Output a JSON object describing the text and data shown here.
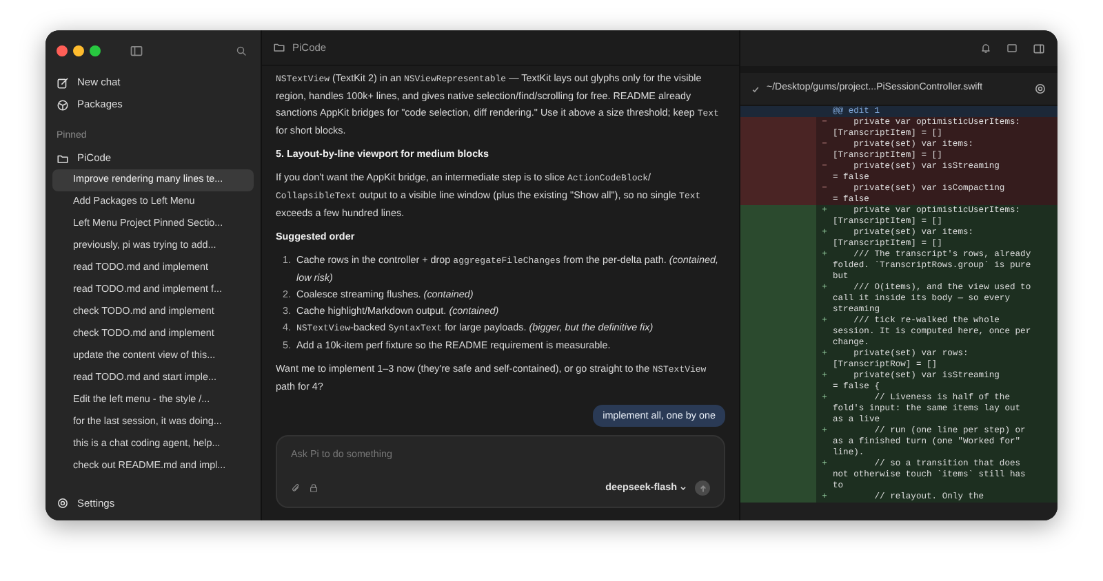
{
  "sidebar": {
    "actions": [
      {
        "kind": "new",
        "label": "New chat"
      },
      {
        "kind": "packages",
        "label": "Packages"
      }
    ],
    "section": "Pinned",
    "project": "PiCode",
    "sessions": [
      {
        "title": "Improve rendering many lines te...",
        "selected": true
      },
      {
        "title": "Add Packages to Left Menu",
        "selected": false
      },
      {
        "title": "Left Menu Project Pinned Sectio...",
        "selected": false
      },
      {
        "title": "previously, pi was trying to add...",
        "selected": false
      },
      {
        "title": "read TODO.md and implement",
        "selected": false
      },
      {
        "title": "read TODO.md and implement f...",
        "selected": false
      },
      {
        "title": "check TODO.md and implement",
        "selected": false
      },
      {
        "title": "check TODO.md and implement",
        "selected": false
      },
      {
        "title": "update the content view of this...",
        "selected": false
      },
      {
        "title": "read TODO.md and start imple...",
        "selected": false
      },
      {
        "title": "Edit the left menu - the style /...",
        "selected": false
      },
      {
        "title": "for the last session, it was doing...",
        "selected": false
      },
      {
        "title": "this is a chat coding agent, help...",
        "selected": false
      },
      {
        "title": "check out README.md and impl...",
        "selected": false
      }
    ],
    "settings": "Settings"
  },
  "chat": {
    "title": "PiCode",
    "blocks": [
      {
        "kind": "para",
        "segments": [
          {
            "kind": "code",
            "text": "NSTextView"
          },
          {
            "kind": "plain",
            "text": " (TextKit 2) in an "
          },
          {
            "kind": "code",
            "text": "NSViewRepresentable"
          },
          {
            "kind": "plain",
            "text": " — TextKit lays out glyphs only for the visible region, handles 100k+ lines, and gives native selection/find/scrolling for free. README already sanctions AppKit bridges for \"code selection, diff rendering.\" Use it above a size threshold; keep "
          },
          {
            "kind": "code",
            "text": "Text"
          },
          {
            "kind": "plain",
            "text": " for short blocks."
          }
        ]
      },
      {
        "kind": "heading",
        "segments": [
          {
            "kind": "plain",
            "text": "5. Layout-by-line viewport for medium blocks"
          }
        ]
      },
      {
        "kind": "para",
        "segments": [
          {
            "kind": "plain",
            "text": "If you don't want the AppKit bridge, an intermediate step is to slice "
          },
          {
            "kind": "code",
            "text": "ActionCodeBlock"
          },
          {
            "kind": "plain",
            "text": "/ "
          },
          {
            "kind": "code",
            "text": "CollapsibleText"
          },
          {
            "kind": "plain",
            "text": " output to a visible line window (plus the existing \"Show all\"), so no single "
          },
          {
            "kind": "code",
            "text": "Text"
          },
          {
            "kind": "plain",
            "text": " exceeds a few hundred lines."
          }
        ]
      },
      {
        "kind": "heading",
        "segments": [
          {
            "kind": "plain",
            "text": "Suggested order"
          }
        ]
      },
      {
        "kind": "list",
        "items": [
          {
            "number": "1.",
            "segments": [
              {
                "kind": "plain",
                "text": "Cache rows in the controller + drop "
              },
              {
                "kind": "code",
                "text": "aggregateFileChanges"
              },
              {
                "kind": "plain",
                "text": " from the per-delta path. "
              },
              {
                "kind": "italic",
                "text": "(contained, low risk)"
              }
            ]
          },
          {
            "number": "2.",
            "segments": [
              {
                "kind": "plain",
                "text": "Coalesce streaming flushes. "
              },
              {
                "kind": "italic",
                "text": "(contained)"
              }
            ]
          },
          {
            "number": "3.",
            "segments": [
              {
                "kind": "plain",
                "text": "Cache highlight/Markdown output. "
              },
              {
                "kind": "italic",
                "text": "(contained)"
              }
            ]
          },
          {
            "number": "4.",
            "segments": [
              {
                "kind": "code",
                "text": "NSTextView"
              },
              {
                "kind": "plain",
                "text": "-backed "
              },
              {
                "kind": "code",
                "text": "SyntaxText"
              },
              {
                "kind": "plain",
                "text": " for large payloads. "
              },
              {
                "kind": "italic",
                "text": "(bigger, but the definitive fix)"
              }
            ]
          },
          {
            "number": "5.",
            "segments": [
              {
                "kind": "plain",
                "text": "Add a 10k-item perf fixture so the README requirement is measurable."
              }
            ]
          }
        ]
      },
      {
        "kind": "para",
        "segments": [
          {
            "kind": "plain",
            "text": "Want me to implement 1–3 now (they're safe and self-contained), or go straight to the "
          },
          {
            "kind": "code",
            "text": "NSTextView"
          },
          {
            "kind": "plain",
            "text": " path for 4?"
          }
        ]
      }
    ],
    "user_message": "implement all, one by one",
    "composer": {
      "placeholder": "Ask Pi to do something",
      "model": "deepseek-flash"
    }
  },
  "diff": {
    "file": "~/Desktop/gums/project...PiSessionController.swift",
    "lines": [
      {
        "kind": "hunk",
        "lines": [
          "@@ edit 1"
        ]
      },
      {
        "kind": "del",
        "sign": "−",
        "lines": [
          "    private var optimisticUserItems:",
          "[TranscriptItem] = []"
        ]
      },
      {
        "kind": "del",
        "sign": "−",
        "lines": [
          "    private(set) var items:",
          "[TranscriptItem] = []"
        ]
      },
      {
        "kind": "del",
        "sign": "−",
        "lines": [
          "    private(set) var isStreaming",
          "= false"
        ]
      },
      {
        "kind": "del",
        "sign": "−",
        "lines": [
          "    private(set) var isCompacting",
          "= false"
        ]
      },
      {
        "kind": "add",
        "sign": "+",
        "lines": [
          "    private var optimisticUserItems:",
          "[TranscriptItem] = []"
        ]
      },
      {
        "kind": "add",
        "sign": "+",
        "lines": [
          "    private(set) var items:",
          "[TranscriptItem] = []"
        ]
      },
      {
        "kind": "add",
        "sign": "+",
        "lines": [
          "    /// The transcript's rows, already",
          "folded. `TranscriptRows.group` is pure",
          "but"
        ]
      },
      {
        "kind": "add",
        "sign": "+",
        "lines": [
          "    /// O(items), and the view used to",
          "call it inside its body — so every",
          "streaming"
        ]
      },
      {
        "kind": "add",
        "sign": "+",
        "lines": [
          "    /// tick re-walked the whole",
          "session. It is computed here, once per",
          "change."
        ]
      },
      {
        "kind": "add",
        "sign": "+",
        "lines": [
          "    private(set) var rows:",
          "[TranscriptRow] = []"
        ]
      },
      {
        "kind": "add",
        "sign": "+",
        "lines": [
          "    private(set) var isStreaming",
          "= false {"
        ]
      },
      {
        "kind": "add",
        "sign": "+",
        "lines": [
          "        // Liveness is half of the",
          "fold's input: the same items lay out",
          "as a live"
        ]
      },
      {
        "kind": "add",
        "sign": "+",
        "lines": [
          "        // run (one line per step) or",
          "as a finished turn (one \"Worked for\"",
          "line)."
        ]
      },
      {
        "kind": "add",
        "sign": "+",
        "lines": [
          "        // so a transition that does",
          "not otherwise touch `items` still has",
          "to"
        ]
      },
      {
        "kind": "add",
        "sign": "+",
        "lines": [
          "        // relayout. Only the"
        ]
      }
    ]
  }
}
